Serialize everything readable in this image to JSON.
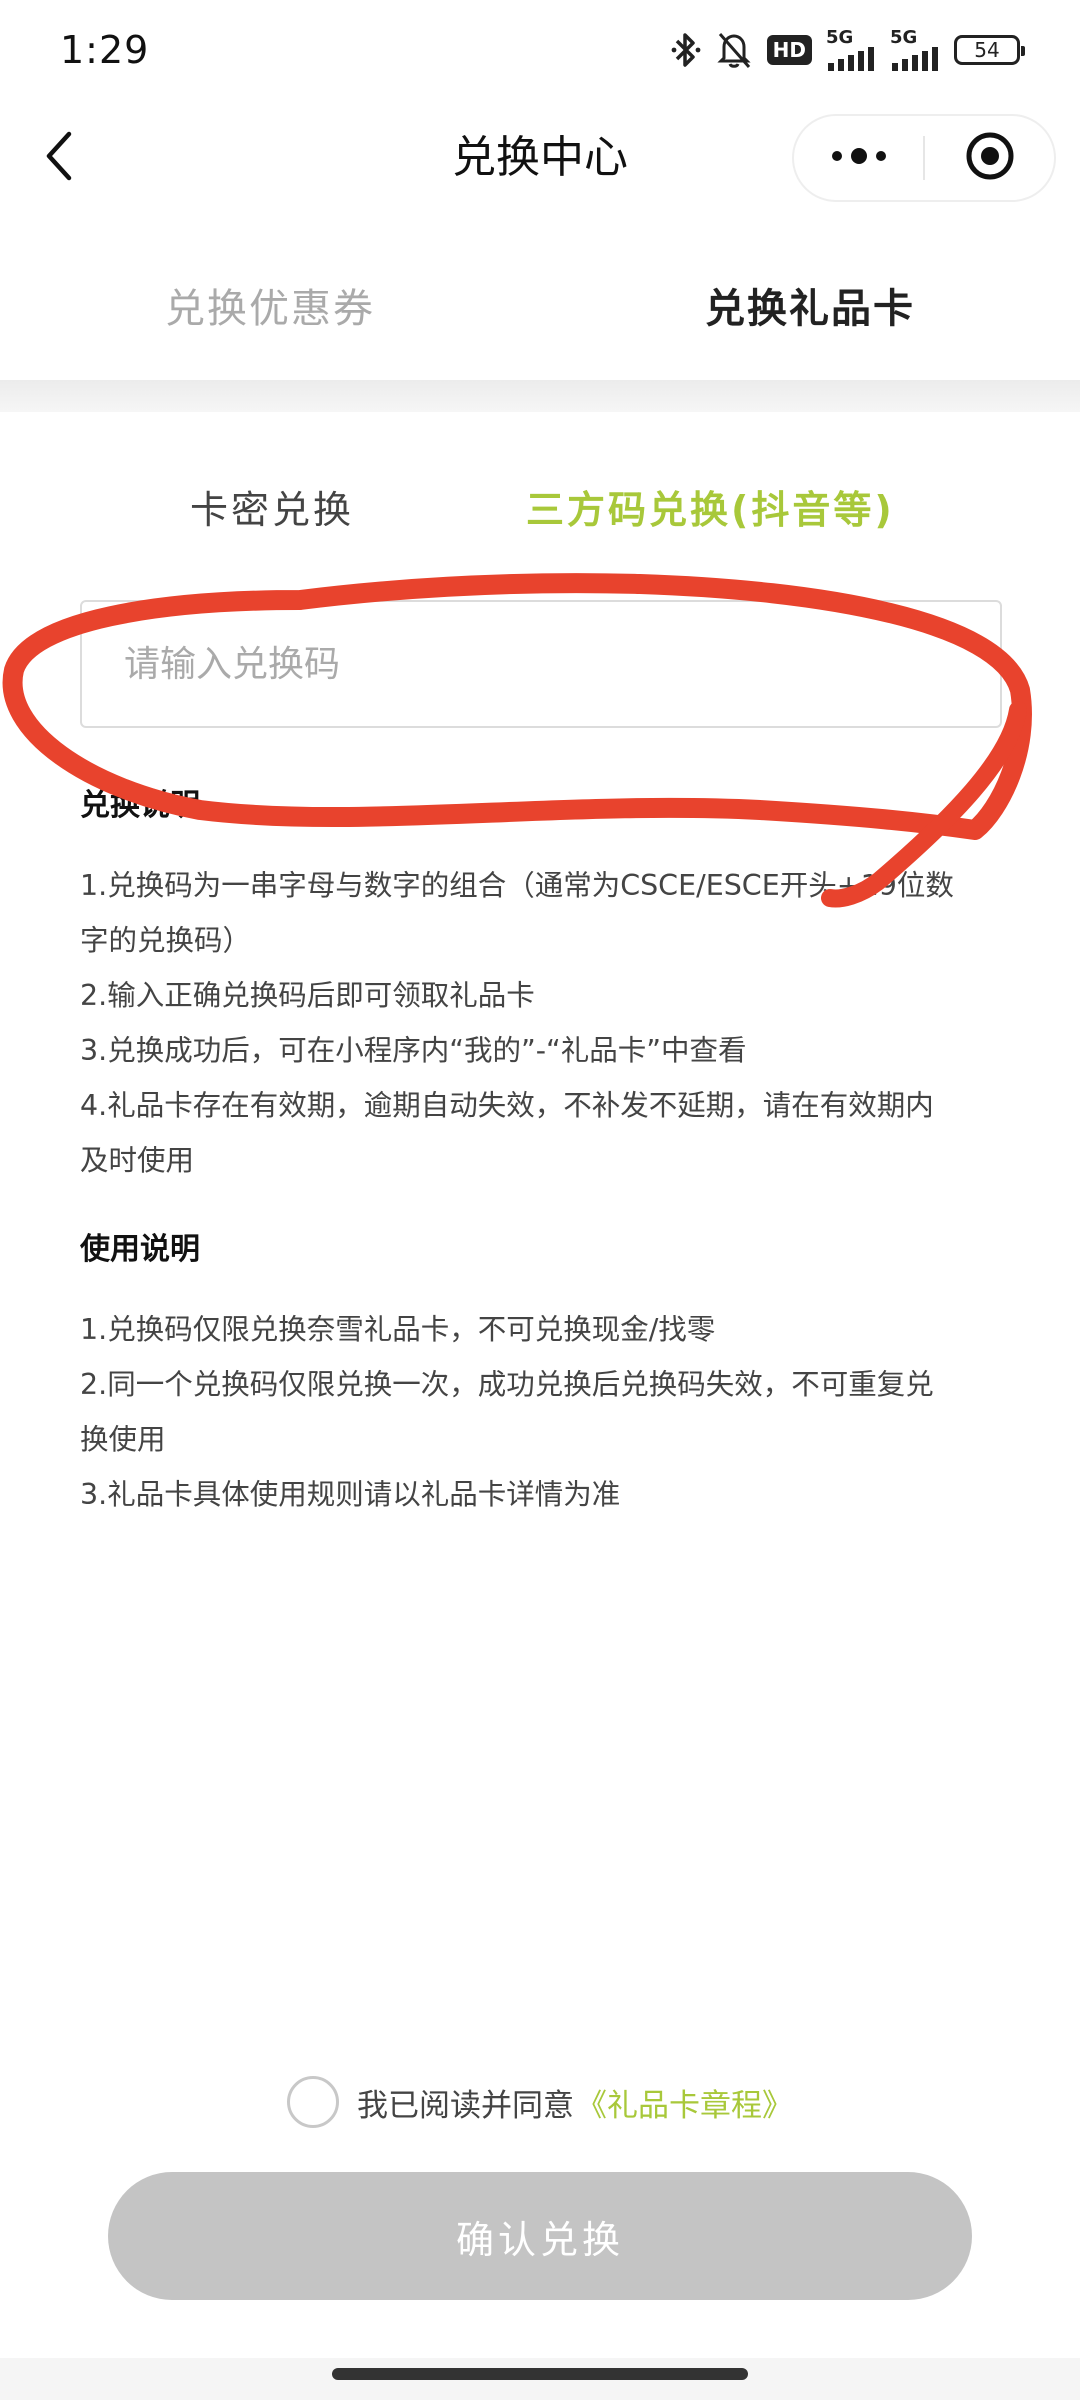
{
  "status_bar": {
    "time": "1:29",
    "hd": "HD",
    "network_1": "5G",
    "network_2": "5G",
    "battery": "54",
    "icons": [
      "bluetooth-icon",
      "bell-off-icon",
      "signal-icon",
      "signal-icon",
      "battery-icon"
    ]
  },
  "nav": {
    "title": "兑换中心",
    "back_icon": "chevron-left-icon",
    "more_icon": "more-dots-icon",
    "close_icon": "target-icon"
  },
  "top_tabs": [
    {
      "label": "兑换优惠券",
      "active": false
    },
    {
      "label": "兑换礼品卡",
      "active": true
    }
  ],
  "sub_tabs": [
    {
      "label": "卡密兑换",
      "active": false
    },
    {
      "label": "三方码兑换(抖音等)",
      "active": true
    }
  ],
  "input": {
    "placeholder": "请输入兑换码",
    "value": ""
  },
  "redeem_info": {
    "title": "兑换说明",
    "lines": [
      "1.兑换码为一串字母与数字的组合（通常为CSCE/ESCE开头+19位数",
      "字的兑换码）",
      "2.输入正确兑换码后即可领取礼品卡",
      "3.兑换成功后，可在小程序内“我的”-“礼品卡”中查看",
      "4.礼品卡存在有效期，逾期自动失效，不补发不延期，请在有效期内",
      "及时使用"
    ]
  },
  "usage_info": {
    "title": "使用说明",
    "lines": [
      "1.兑换码仅限兑换奈雪礼品卡，不可兑换现金/找零",
      "2.同一个兑换码仅限兑换一次，成功兑换后兑换码失效，不可重复兑",
      "换使用",
      "3.礼品卡具体使用规则请以礼品卡详情为准"
    ]
  },
  "agreement": {
    "text": "我已阅读并同意",
    "link": "《礼品卡章程》",
    "checked": false
  },
  "confirm_button": {
    "label": "确认兑换"
  },
  "colors": {
    "accent": "#a8c83a",
    "disabled_button": "#c4c4c4",
    "annotation": "#e8432d"
  }
}
